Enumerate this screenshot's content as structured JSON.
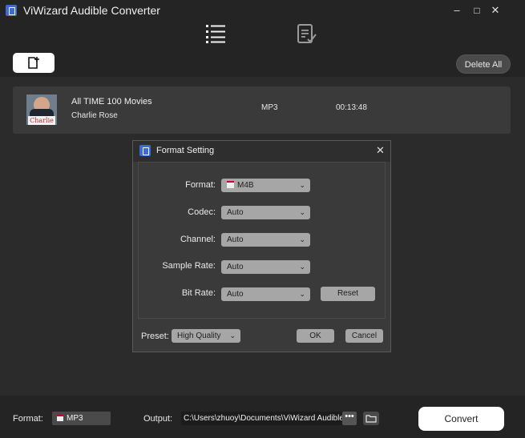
{
  "window": {
    "title": "ViWizard Audible Converter",
    "minimize": "–",
    "maximize": "□",
    "close": "✕"
  },
  "tabs": [
    {
      "icon": "list-icon"
    },
    {
      "icon": "converted-list-icon"
    }
  ],
  "toolbar": {
    "add_icon": "add-file-icon",
    "delete_all_label": "Delete All"
  },
  "files": [
    {
      "title": "All TIME 100 Movies",
      "author": "Charlie Rose",
      "format": "MP3",
      "duration": "00:13:48",
      "cover_text": "Charlie Rose"
    }
  ],
  "dialog": {
    "title": "Format Setting",
    "close": "✕",
    "fields": {
      "format": {
        "label": "Format:",
        "value": "M4B"
      },
      "codec": {
        "label": "Codec:",
        "value": "Auto"
      },
      "channel": {
        "label": "Channel:",
        "value": "Auto"
      },
      "sample_rate": {
        "label": "Sample Rate:",
        "value": "Auto"
      },
      "bit_rate": {
        "label": "Bit Rate:",
        "value": "Auto"
      }
    },
    "reset_label": "Reset",
    "preset_label": "Preset:",
    "preset_value": "High Quality",
    "ok_label": "OK",
    "cancel_label": "Cancel"
  },
  "bottom": {
    "format_label": "Format:",
    "format_value": "MP3",
    "output_label": "Output:",
    "output_path": "C:\\Users\\zhuoy\\Documents\\ViWizard Audible",
    "more_label": "•••",
    "convert_label": "Convert"
  },
  "colors": {
    "background": "#2b2b2b",
    "bar": "#242424",
    "accent": "#3d6bd6",
    "control": "#a6a6a6"
  }
}
